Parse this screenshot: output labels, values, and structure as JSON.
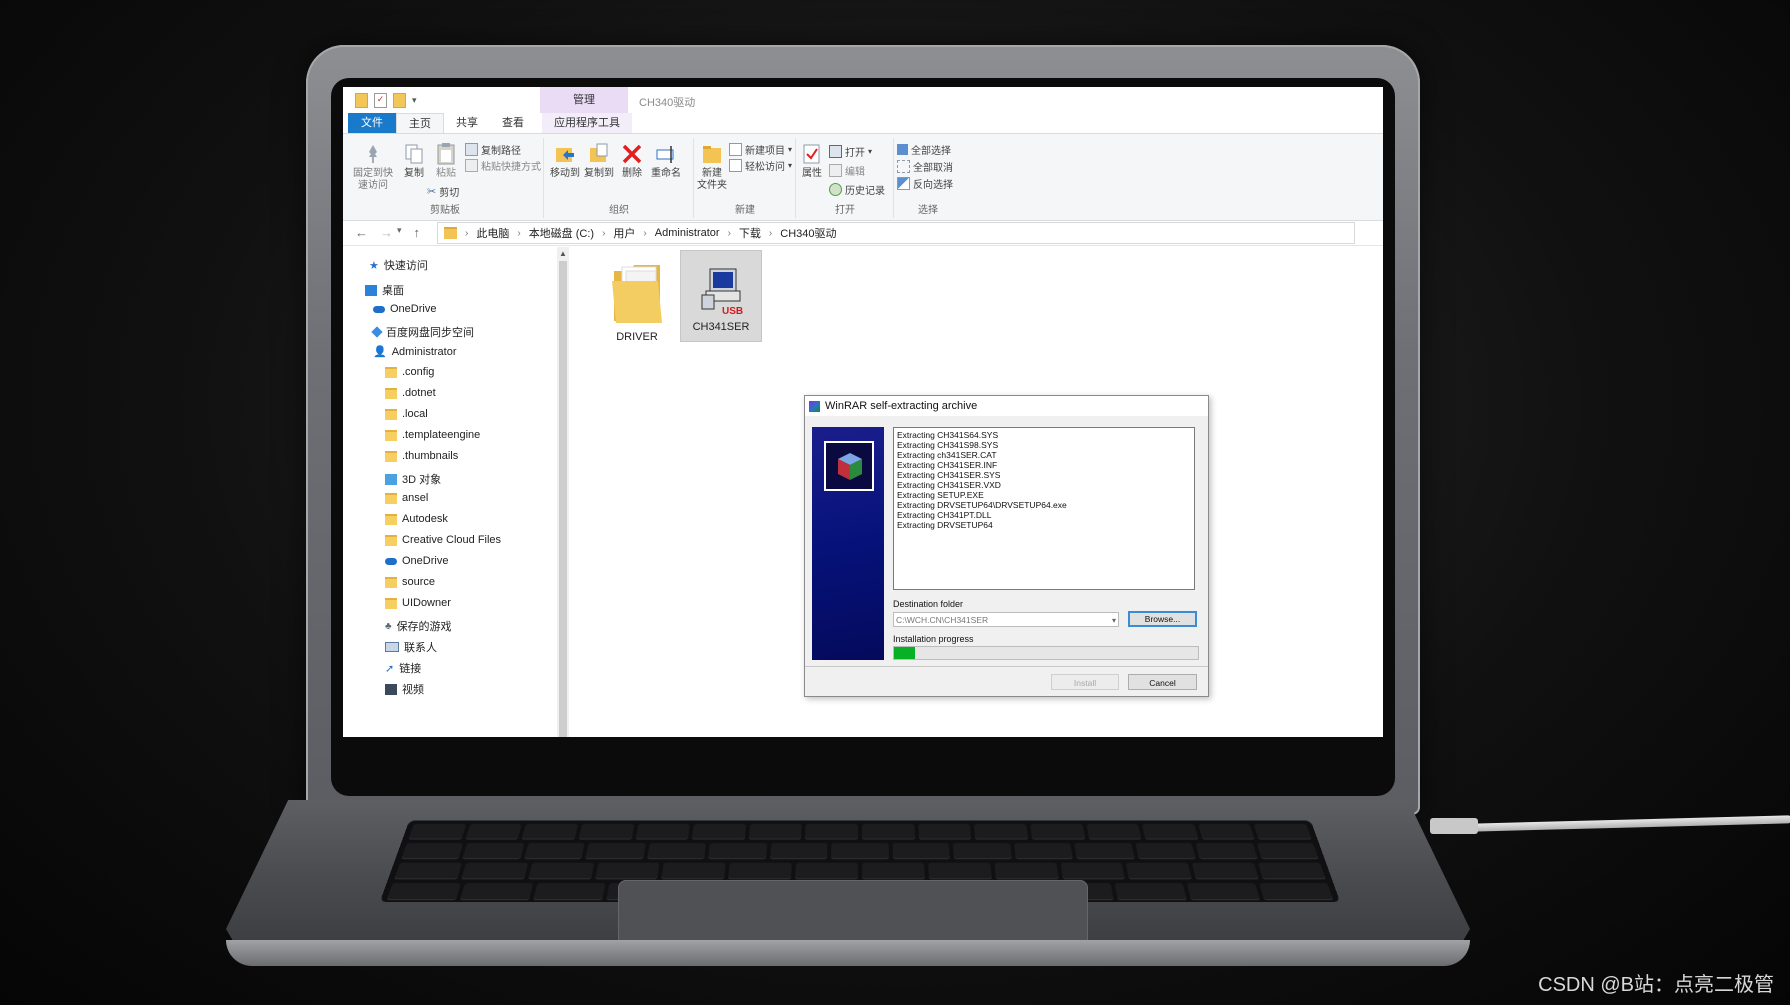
{
  "window": {
    "title": "CH340驱动",
    "manage_tab": "管理"
  },
  "tabs": [
    "文件",
    "主页",
    "共享",
    "查看",
    "应用程序工具"
  ],
  "ribbon": {
    "clipboard": {
      "label": "剪贴板",
      "pin": "固定到快\n速访问",
      "copy": "复制",
      "paste": "粘贴",
      "copy_path": "复制路径",
      "paste_shortcut": "粘贴快捷方式",
      "cut": "剪切"
    },
    "organize": {
      "label": "组织",
      "move_to": "移动到",
      "copy_to": "复制到",
      "delete": "删除",
      "rename": "重命名"
    },
    "new": {
      "label": "新建",
      "new_folder": "新建\n文件夹",
      "new_item": "新建项目",
      "easy_access": "轻松访问"
    },
    "open": {
      "label": "打开",
      "properties": "属性",
      "open": "打开",
      "edit": "编辑",
      "history": "历史记录"
    },
    "select": {
      "label": "选择",
      "select_all": "全部选择",
      "select_none": "全部取消",
      "invert": "反向选择"
    }
  },
  "address": {
    "crumbs": [
      "此电脑",
      "本地磁盘 (C:)",
      "用户",
      "Administrator",
      "下载",
      "CH340驱动"
    ]
  },
  "nav_pane": {
    "items": [
      {
        "label": "快速访问",
        "icon": "star-icon"
      },
      {
        "label": "桌面",
        "icon": "desktop-icon"
      },
      {
        "label": "OneDrive",
        "icon": "cloud-icon"
      },
      {
        "label": "百度网盘同步空间",
        "icon": "baidu-icon"
      },
      {
        "label": "Administrator",
        "icon": "user-icon"
      },
      {
        "label": ".config",
        "icon": "folder-icon"
      },
      {
        "label": ".dotnet",
        "icon": "folder-icon"
      },
      {
        "label": ".local",
        "icon": "folder-icon"
      },
      {
        "label": ".templateengine",
        "icon": "folder-icon"
      },
      {
        "label": ".thumbnails",
        "icon": "folder-icon"
      },
      {
        "label": "3D 对象",
        "icon": "3d-objects-icon"
      },
      {
        "label": "ansel",
        "icon": "folder-icon"
      },
      {
        "label": "Autodesk",
        "icon": "folder-icon"
      },
      {
        "label": "Creative Cloud Files",
        "icon": "folder-icon"
      },
      {
        "label": "OneDrive",
        "icon": "cloud-icon"
      },
      {
        "label": "source",
        "icon": "folder-icon"
      },
      {
        "label": "UIDowner",
        "icon": "folder-icon"
      },
      {
        "label": "保存的游戏",
        "icon": "saved-games-icon"
      },
      {
        "label": "联系人",
        "icon": "contacts-icon"
      },
      {
        "label": "链接",
        "icon": "links-icon"
      },
      {
        "label": "视频",
        "icon": "videos-icon"
      }
    ]
  },
  "files": [
    {
      "name": "DRIVER",
      "icon": "folder-icon"
    },
    {
      "name": "CH341SER",
      "icon": "usb-setup-icon",
      "selected": true
    }
  ],
  "dialog": {
    "title": "WinRAR self-extracting archive",
    "log": [
      "Extracting CH341S64.SYS",
      "Extracting CH341S98.SYS",
      "Extracting ch341SER.CAT",
      "Extracting CH341SER.INF",
      "Extracting CH341SER.SYS",
      "Extracting CH341SER.VXD",
      "Extracting SETUP.EXE",
      "Extracting DRVSETUP64\\DRVSETUP64.exe",
      "Extracting CH341PT.DLL",
      "Extracting DRVSETUP64"
    ],
    "destination_label": "Destination folder",
    "destination_value": "C:\\WCH.CN\\CH341SER",
    "browse": "Browse...",
    "progress_label": "Installation progress",
    "progress_fraction": 0.07,
    "install": "Install",
    "cancel": "Cancel"
  },
  "watermark": "CSDN @B站：点亮二极管",
  "colors": {
    "file_tab": "#1979ca",
    "manage_tab": "#eadcf5",
    "progress_fill": "#07b025",
    "dialog_side": "#06127a",
    "delete_red": "#e02020"
  }
}
